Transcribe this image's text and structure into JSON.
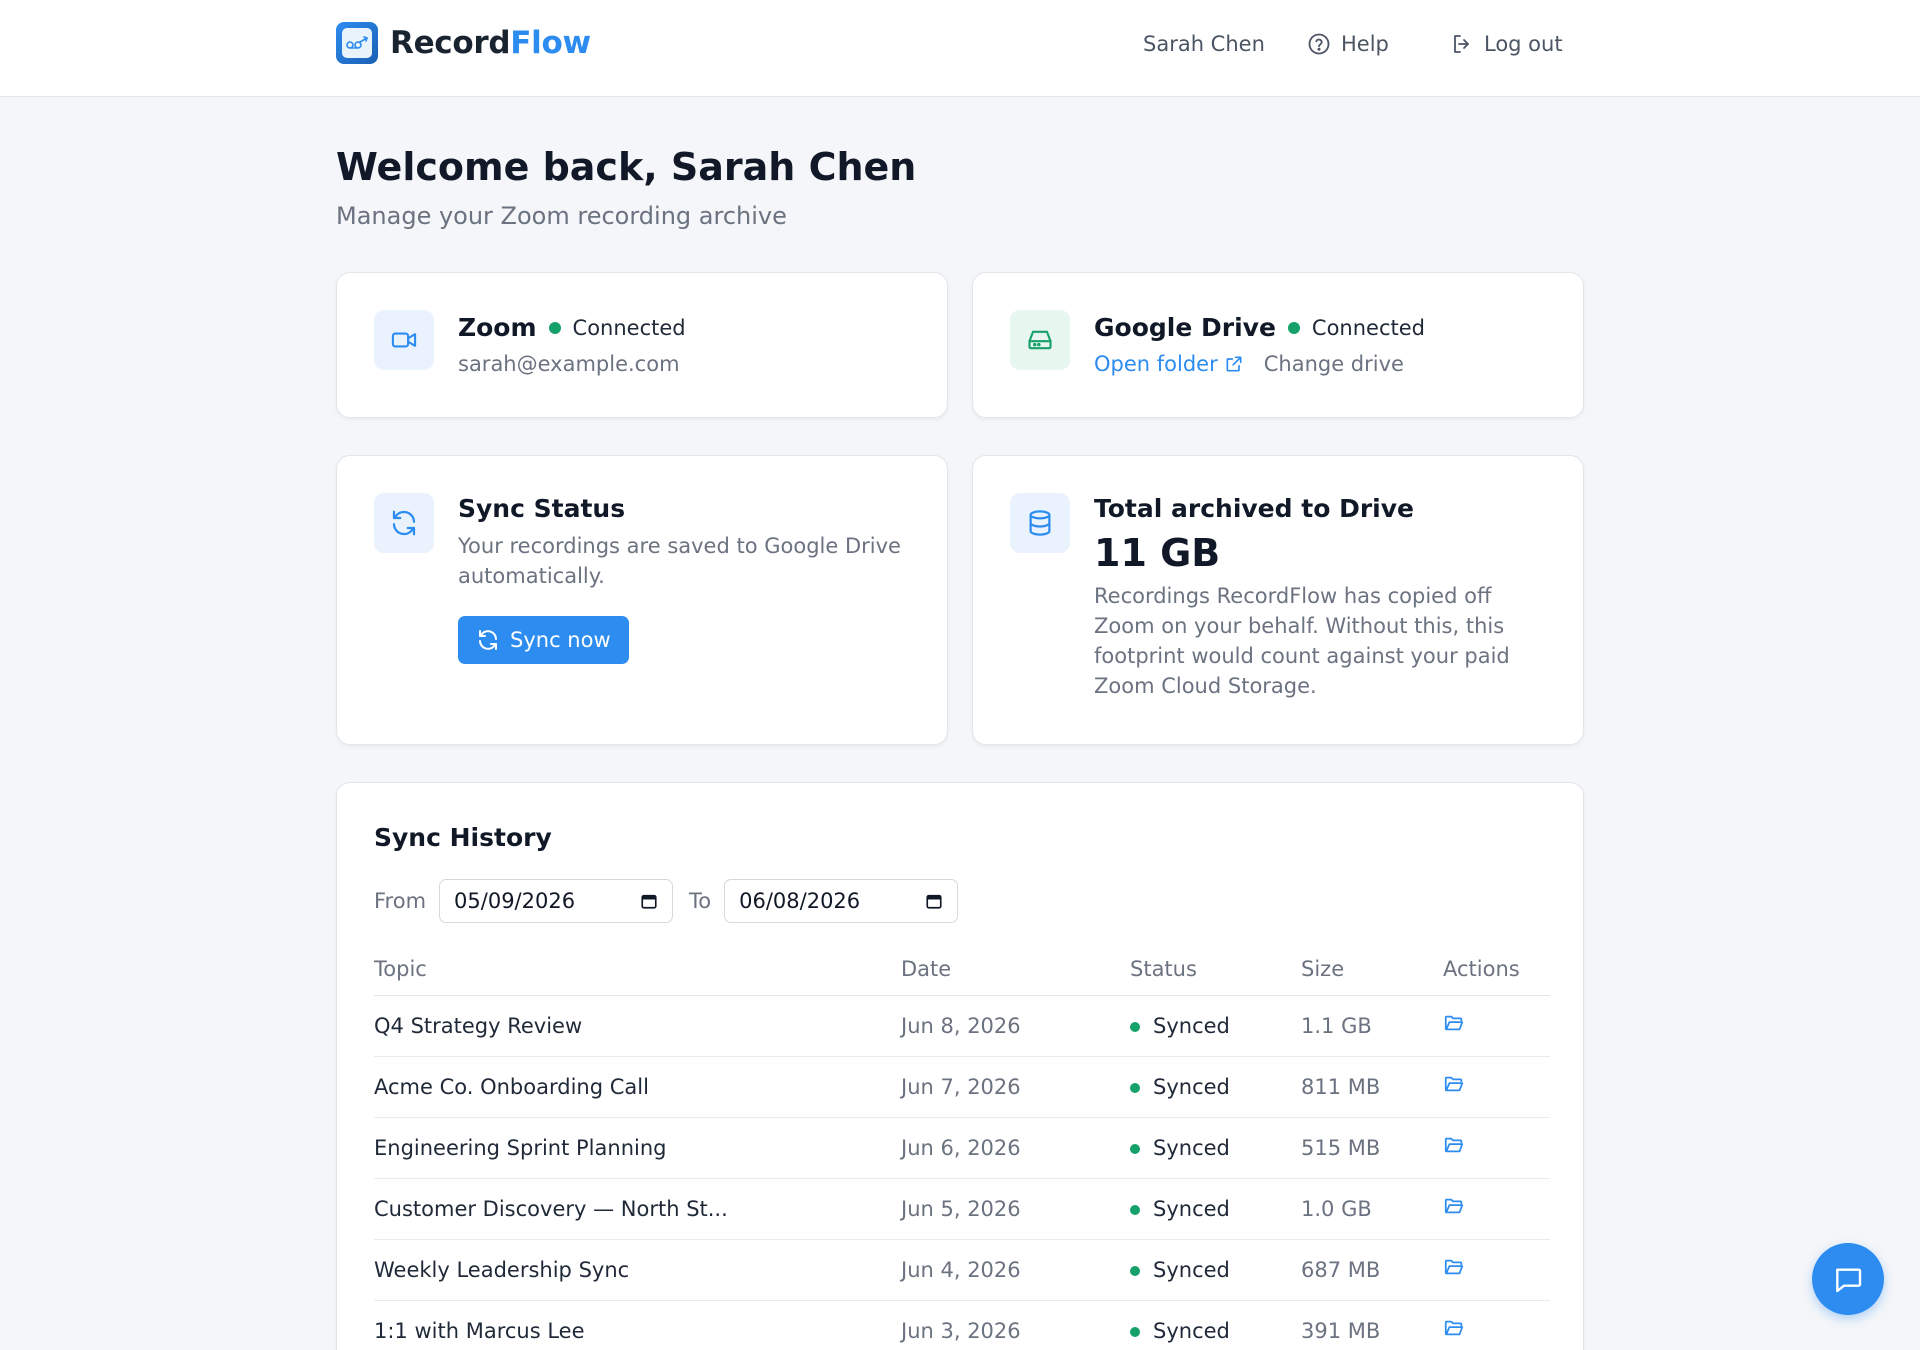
{
  "header": {
    "brand_part1": "Record",
    "brand_part2": "Flow",
    "user_name": "Sarah Chen",
    "help_label": "Help",
    "logout_label": "Log out"
  },
  "welcome": {
    "title": "Welcome back, Sarah Chen",
    "subtitle": "Manage your Zoom recording archive"
  },
  "zoom_card": {
    "title": "Zoom",
    "status": "Connected",
    "email": "sarah@example.com"
  },
  "drive_card": {
    "title": "Google Drive",
    "status": "Connected",
    "open_folder": "Open folder",
    "change_drive": "Change drive"
  },
  "sync_card": {
    "title": "Sync Status",
    "description": "Your recordings are saved to Google Drive automatically.",
    "button": "Sync now"
  },
  "archive_card": {
    "title": "Total archived to Drive",
    "value": "11 GB",
    "description": "Recordings RecordFlow has copied off Zoom on your behalf. Without this, this footprint would count against your paid Zoom Cloud Storage."
  },
  "history": {
    "title": "Sync History",
    "from_label": "From",
    "from_value": "05/09/2026",
    "to_label": "To",
    "to_value": "06/08/2026",
    "columns": [
      "Topic",
      "Date",
      "Status",
      "Size",
      "Actions"
    ],
    "rows": [
      {
        "topic": "Q4 Strategy Review",
        "date": "Jun 8, 2026",
        "status": "Synced",
        "size": "1.1 GB"
      },
      {
        "topic": "Acme Co. Onboarding Call",
        "date": "Jun 7, 2026",
        "status": "Synced",
        "size": "811 MB"
      },
      {
        "topic": "Engineering Sprint Planning",
        "date": "Jun 6, 2026",
        "status": "Synced",
        "size": "515 MB"
      },
      {
        "topic": "Customer Discovery — North St...",
        "date": "Jun 5, 2026",
        "status": "Synced",
        "size": "1.0 GB"
      },
      {
        "topic": "Weekly Leadership Sync",
        "date": "Jun 4, 2026",
        "status": "Synced",
        "size": "687 MB"
      },
      {
        "topic": "1:1 with Marcus Lee",
        "date": "Jun 3, 2026",
        "status": "Synced",
        "size": "391 MB"
      }
    ]
  },
  "colors": {
    "accent": "#2d8cf0",
    "success": "#16a06a",
    "background": "#f4f6f9"
  },
  "icons": {
    "brand": "recordflow-logo-icon",
    "help": "help-circle-icon",
    "logout": "logout-icon",
    "zoom": "video-camera-icon",
    "drive": "hard-drive-icon",
    "sync": "refresh-icon",
    "archive": "database-icon",
    "external": "external-link-icon",
    "calendar": "calendar-icon",
    "folder": "folder-open-icon",
    "chat": "chat-icon"
  }
}
